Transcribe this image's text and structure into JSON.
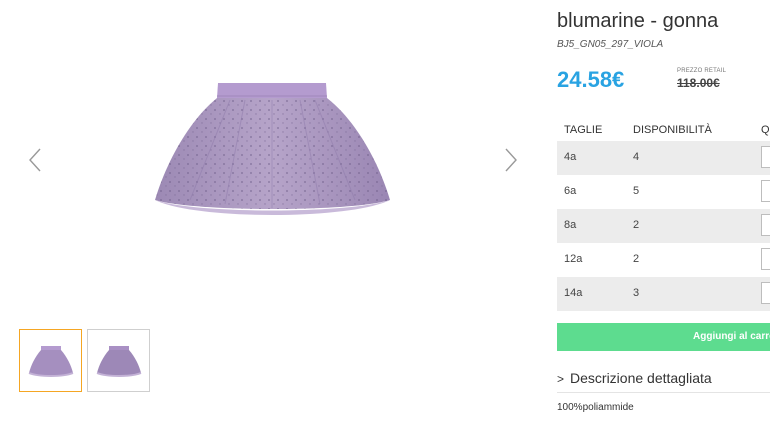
{
  "product": {
    "title": "blumarine - gonna",
    "sku": "BJ5_GN05_297_VIOLA",
    "price": "24.58€",
    "retail_label": "PREZZO RETAIL",
    "retail_price": "118.00€"
  },
  "gallery": {
    "main_image": "purple-tulle-skirt",
    "thumbnails": [
      "purple-tulle-skirt-front",
      "purple-tulle-skirt-back"
    ],
    "selected_thumbnail": 1,
    "prev_icon": "chevron-left-icon",
    "next_icon": "chevron-right-icon"
  },
  "sizes_table": {
    "headers": {
      "size": "TAGLIE",
      "availability": "DISPONIBILITÀ",
      "quantity": "Q"
    },
    "rows": [
      {
        "size": "4a",
        "availability": "4"
      },
      {
        "size": "6a",
        "availability": "5"
      },
      {
        "size": "8a",
        "availability": "2"
      },
      {
        "size": "12a",
        "availability": "2"
      },
      {
        "size": "14a",
        "availability": "3"
      }
    ]
  },
  "cart": {
    "button_label": "Aggiungi al carrello"
  },
  "description": {
    "toggle_label": "Descrizione dettagliata",
    "text": "100%poliammide"
  },
  "colors": {
    "price": "#29a3e2",
    "cart_button": "#5ddc8f",
    "selected_thumb_border": "#f5a623",
    "skirt": "#a58fbf",
    "waistband": "#b49bcf"
  }
}
